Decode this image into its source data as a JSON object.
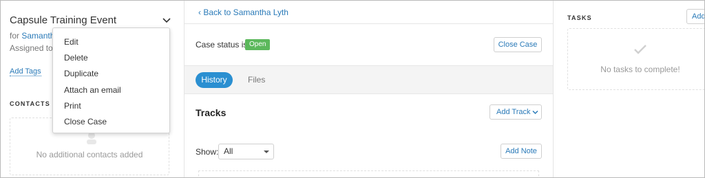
{
  "case": {
    "title": "Capsule Training Event",
    "for_prefix": "for",
    "for_link": "Samantha",
    "assigned_prefix": "Assigned to S",
    "add_tags": "Add Tags"
  },
  "menu": {
    "items": [
      "Edit",
      "Delete",
      "Duplicate",
      "Attach an email",
      "Print",
      "Close Case"
    ]
  },
  "contacts": {
    "heading": "CONTACTS",
    "empty_text": "No additional contacts added"
  },
  "main": {
    "back_link": "‹ Back to Samantha Lyth",
    "status_label": "Case status is",
    "status_value": "Open",
    "close_case": "Close Case",
    "tabs": [
      {
        "label": "History",
        "active": true
      },
      {
        "label": "Files",
        "active": false
      }
    ],
    "tracks_title": "Tracks",
    "add_track": "Add Track",
    "show_label": "Show:",
    "show_value": "All",
    "add_note": "Add Note"
  },
  "tasks": {
    "heading": "TASKS",
    "add_button": "Add",
    "empty_text": "No tasks to complete!"
  },
  "colors": {
    "link": "#2a7ab8",
    "active_tab": "#2a8fd1",
    "status_open": "#5cb85c",
    "tab_bar_bg": "#f4f4f4"
  },
  "icons": {
    "case_menu": "chevron-down-icon",
    "add_track": "chevron-down-icon",
    "contacts_placeholder": "person-icon",
    "tasks_placeholder": "check-icon"
  }
}
